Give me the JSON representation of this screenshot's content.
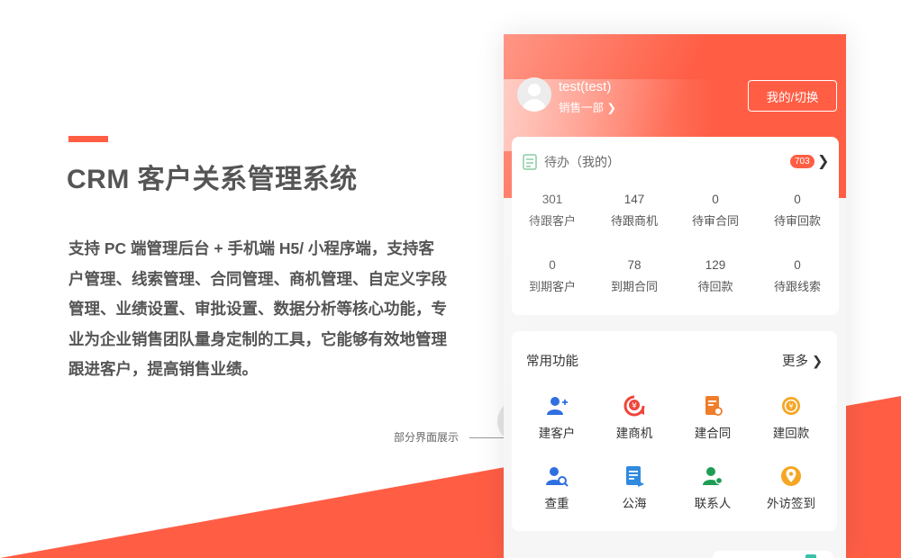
{
  "headline": "CRM 客户关系管理系统",
  "description": "支持 PC 端管理后台 + 手机端 H5/ 小程序端，支持客户管理、线索管理、合同管理、商机管理、自定义字段管理、业绩设置、审批设置、数据分析等核心功能，专业为企业销售团队量身定制的工具，它能够有效地管理跟进客户，提高销售业绩。",
  "caption": "部分界面展示",
  "colors": {
    "accent": "#ff5e45",
    "card_bg": "#ffffff",
    "phone_bg": "#f6f6f6"
  },
  "phone": {
    "user": {
      "name": "test(test)",
      "dept": "销售一部 ❯"
    },
    "switch_button": "我的/切换",
    "todo": {
      "title": "待办（我的）",
      "badge": "703",
      "arrow": "❯",
      "stats": [
        {
          "value": "301",
          "label": "待跟客户"
        },
        {
          "value": "147",
          "label": "待跟商机"
        },
        {
          "value": "0",
          "label": "待审合同"
        },
        {
          "value": "0",
          "label": "待审回款"
        },
        {
          "value": "0",
          "label": "到期客户"
        },
        {
          "value": "78",
          "label": "到期合同"
        },
        {
          "value": "129",
          "label": "待回款"
        },
        {
          "value": "0",
          "label": "待跟线索"
        }
      ]
    },
    "functions": {
      "title": "常用功能",
      "more": "更多 ❯",
      "items": [
        {
          "label": "建客户",
          "icon": "add-customer-icon"
        },
        {
          "label": "建商机",
          "icon": "add-opportunity-icon"
        },
        {
          "label": "建合同",
          "icon": "add-contract-icon"
        },
        {
          "label": "建回款",
          "icon": "add-payment-icon"
        },
        {
          "label": "查重",
          "icon": "duplicate-check-icon"
        },
        {
          "label": "公海",
          "icon": "public-pool-icon"
        },
        {
          "label": "联系人",
          "icon": "contacts-icon"
        },
        {
          "label": "外访签到",
          "icon": "check-in-icon"
        }
      ]
    }
  }
}
